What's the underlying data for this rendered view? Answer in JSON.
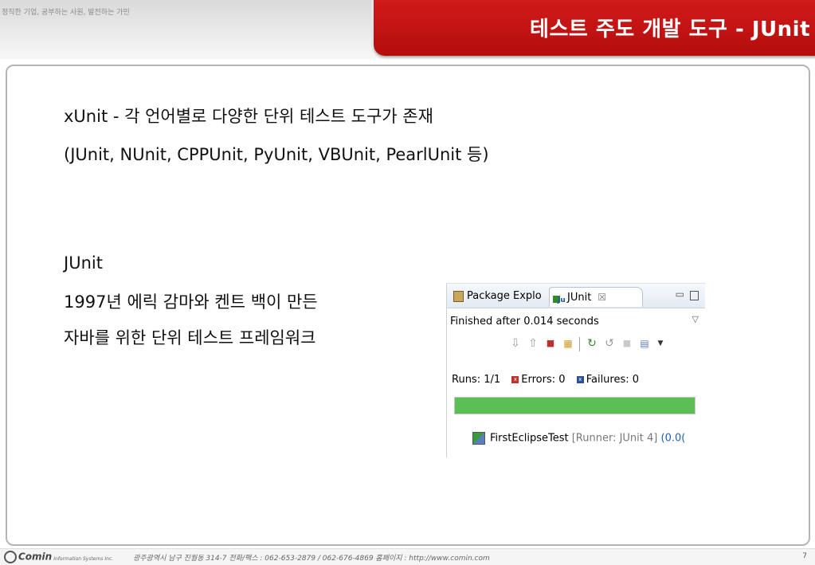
{
  "header": {
    "tagline": "정직한 기업, 공부하는 사원, 발전하는 가민",
    "title": "테스트 주도 개발 도구 - JUnit"
  },
  "content": {
    "lines": [
      "xUnit - 각 언어별로 다양한 단위 테스트 도구가 존재",
      "(JUnit, NUnit, CPPUnit, PyUnit, VBUnit, PearlUnit 등)",
      "JUnit",
      "1997년 에릭 감마와 켄트 백이 만든",
      "자바를 위한 단위 테스트 프레임워크"
    ]
  },
  "eclipse_panel": {
    "tabs": [
      {
        "label": "Package Explo",
        "icon": "package-explorer-icon"
      },
      {
        "label": "JUnit",
        "icon": "junit-icon",
        "close": "☒"
      }
    ],
    "window_buttons": {
      "minimize": "▭",
      "maximize": "□"
    },
    "status": "Finished after 0.014 seconds",
    "view_menu": "▽",
    "toolbar_icons": [
      "next-failure-icon",
      "previous-failure-icon",
      "show-failures-only-icon",
      "scroll-lock-icon",
      "rerun-test-icon",
      "rerun-failed-first-icon",
      "stop-icon",
      "history-icon"
    ],
    "counts": {
      "runs_label": "Runs:",
      "runs_value": "1/1",
      "errors_label": "Errors:",
      "errors_value": "0",
      "failures_label": "Failures:",
      "failures_value": "0"
    },
    "progress": {
      "fraction": 1.0,
      "color": "#5cbf55"
    },
    "tree": {
      "test_name": "FirstEclipseTest",
      "runner": "[Runner: JUnit 4]",
      "time": "(0.0("
    }
  },
  "footer": {
    "logo": "Comin",
    "logo_sub": "Information Systems Inc.",
    "address": "광주광역시 남구 진월동 314-7   전화/팩스 : 062-653-2879 / 062-676-4869  홈페이지 : http://www.comin.com",
    "page": "7"
  },
  "colors": {
    "accent": "#c41212",
    "progress": "#5cbf55"
  }
}
